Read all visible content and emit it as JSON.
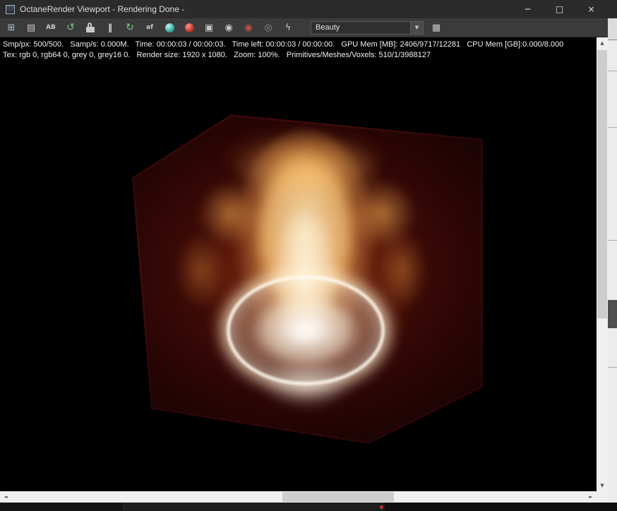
{
  "window": {
    "title": "OctaneRender Viewport - Rendering Done -",
    "minimize": "─",
    "maximize": "□",
    "close": "×"
  },
  "toolbar": {
    "icons": [
      {
        "name": "viewport-fit-icon",
        "glyph": "⊞"
      },
      {
        "name": "copy-image-icon",
        "glyph": "▤"
      },
      {
        "name": "ab-compare-icon",
        "glyph": "AB"
      },
      {
        "name": "restart-render-icon",
        "glyph": "↺"
      },
      {
        "name": "lock-icon",
        "glyph": "",
        "shape": "css-padlock"
      },
      {
        "name": "pause-render-icon",
        "glyph": "‖"
      },
      {
        "name": "refresh-render-icon",
        "glyph": "↻"
      },
      {
        "name": "autofocus-picker-icon",
        "glyph": "af"
      },
      {
        "name": "white-balance-picker-icon",
        "glyph": "",
        "shape": "css-ball",
        "color": "#3fb6b2"
      },
      {
        "name": "material-picker-icon",
        "glyph": "",
        "shape": "css-ball",
        "color": "#c23b2e"
      },
      {
        "name": "object-picker-icon",
        "glyph": "▣"
      },
      {
        "name": "camera-icon",
        "glyph": "◉"
      },
      {
        "name": "render-region-icon",
        "glyph": "◉",
        "color": "#d14a3a"
      },
      {
        "name": "film-camera-icon",
        "glyph": "◎"
      },
      {
        "name": "render-priority-icon",
        "glyph": "ϟ"
      },
      {
        "name": "render-passes-icon",
        "glyph": "▦"
      }
    ],
    "render_pass_select": {
      "value": "Beauty",
      "chevron": "▼"
    }
  },
  "status": {
    "line1": "Smp/px: 500/500.   Samp/s: 0.000M.   Time: 00:00:03 / 00:00:03.   Time left: 00:00:03 / 00:00:00.   GPU Mem [MB]: 2406/9717/12281   CPU Mem [GB]:0.000/8.000",
    "line2": "Tex: rgb 0, rgb64 0, grey 0, grey16 0.   Render size: 1920 x 1080.   Zoom: 100%.   Primitives/Meshes/Voxels: 510/1/3988127"
  },
  "scrollbar": {
    "up": "▲",
    "down": "▼",
    "left": "◄",
    "right": "►"
  },
  "render": {
    "colors": {
      "background": "#000000",
      "volume_box": "#42100a",
      "flame_core": "#fff6e0",
      "flame_mid": "#f6c376",
      "flame_outer": "#b06a26",
      "glow": "#ff9f3c"
    }
  }
}
